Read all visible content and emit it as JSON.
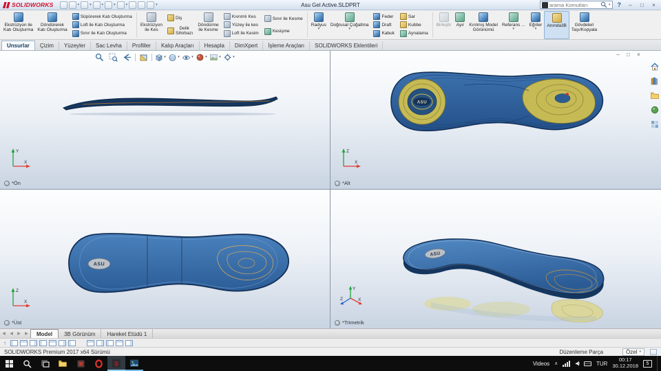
{
  "titlebar": {
    "brand": "SOLIDWORKS",
    "title": "Asu Gel Active.SLDPRT",
    "search_placeholder": "arama Komutları",
    "help": "?"
  },
  "glyphs": {
    "caret": "▾",
    "minimize": "–",
    "maximize": "□",
    "close": "×",
    "prev": "◀",
    "next": "▶",
    "collapse": "↑",
    "chevron_up": "∧",
    "speaker": "◀)",
    "sw": "S"
  },
  "ribbon": {
    "boss_extrude_1": "Ekstrüzyon ile",
    "boss_extrude_2": "Katı Oluşturma",
    "boss_revolve_1": "Döndürerek",
    "boss_revolve_2": "Katı Oluşturma",
    "boss_sweep": "Süpürerek Katı Oluşturma",
    "boss_loft": "Loft ile Katı Oluşturma",
    "boss_boundary": "Sınır ile Katı Oluşturma",
    "cut_extrude_1": "Ekstrüzyon",
    "cut_extrude_2": "ile Kes",
    "thread": "Diş",
    "hole_1": "Delik",
    "hole_2": "Sihirbazı",
    "cut_revolve_1": "Döndürme",
    "cut_revolve_2": "ile Kesme",
    "cut_sweep": "Kıvrımlı Kes",
    "cut_surface": "Yüzey ile kes",
    "cut_loft": "Loft ile Kesim",
    "cut_boundary": "Sınır ile Kesme",
    "intersect": "Kesişme",
    "fillet": "Radyus",
    "pattern": "Doğrusal Çoğaltma",
    "rib": "Feder",
    "draft": "Draft",
    "shell": "Kabuk",
    "wrap": "Sar",
    "dome": "Kubbe",
    "mirror": "Aynalama",
    "combine": "Birleştir",
    "split": "Ayır",
    "exploded_1": "Kırılmış Model",
    "exploded_2": "Görünümü",
    "reference": "Referans ...",
    "curves": "Eğriler",
    "instant3d": "Anında3B",
    "movecopy_1": "Gövdeleri",
    "movecopy_2": "Taşı/Kopyala"
  },
  "tabs": [
    "Unsurlar",
    "Çizim",
    "Yüzeyler",
    "Sac Levha",
    "Profiller",
    "Kalıp Araçları",
    "Hesapla",
    "DimXpert",
    "İşleme Araçları",
    "SOLIDWORKS Eklentileri"
  ],
  "axes": {
    "x": "X",
    "y": "Y",
    "z": "Z"
  },
  "viewport": {
    "model_text": "ASU",
    "views": [
      {
        "label": "*Ön"
      },
      {
        "label": "*Alt"
      },
      {
        "label": "*Üst"
      },
      {
        "label": "*Trimetrik"
      }
    ]
  },
  "bottom_tabs": [
    "Model",
    "3B Görünüm",
    "Hareket Etüdü 1"
  ],
  "statusbar": {
    "left": "SOLIDWORKS Premium 2017 x64 Sürümü",
    "mode": "Düzenleme Parça",
    "dropdown": "Özel"
  },
  "taskbar": {
    "tray_label": "Videos",
    "lang": "TUR",
    "time": "00:17",
    "date": "30.12.2018",
    "badge": "5"
  }
}
